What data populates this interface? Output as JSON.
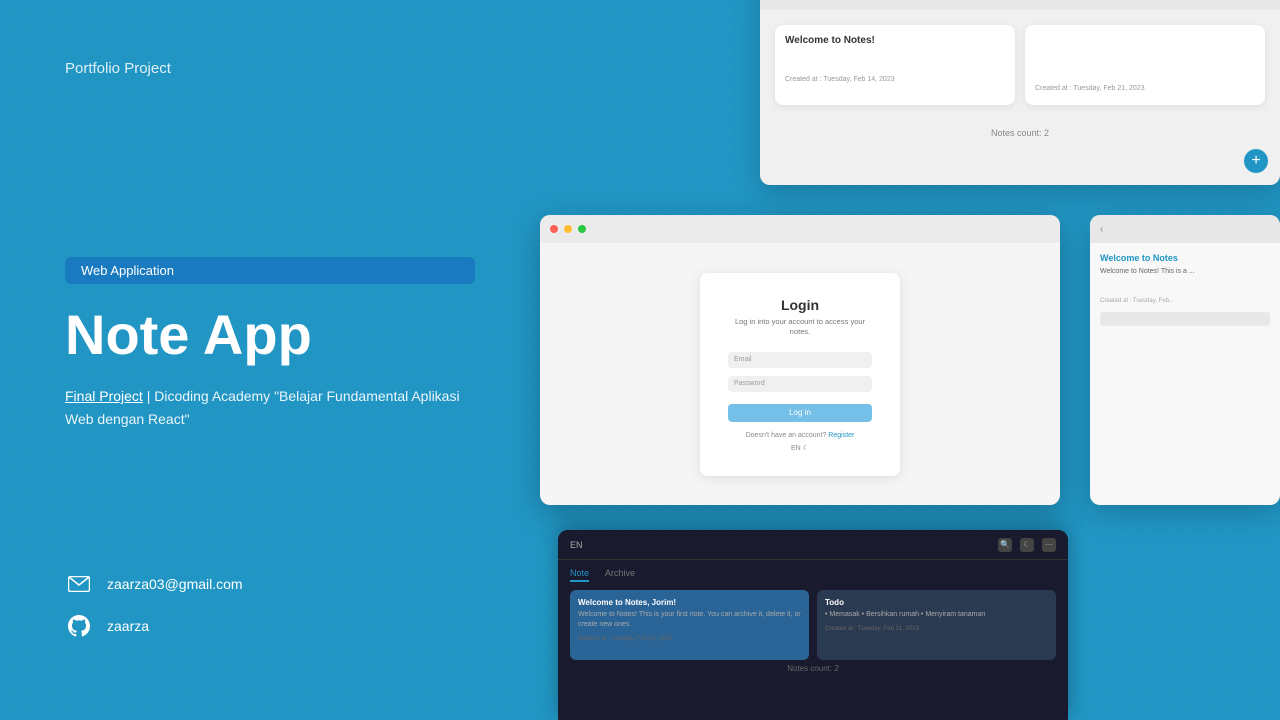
{
  "header": {
    "portfolio_label": "Portfolio Project"
  },
  "badge": {
    "text": "Web Application"
  },
  "app": {
    "title": "Note App",
    "description_link": "Final Project",
    "description_rest": " | Dicoding Academy \"Belajar Fundamental Aplikasi Web dengan React\""
  },
  "contact": {
    "email": "zaarza03@gmail.com",
    "github": "zaarza"
  },
  "screenshots": {
    "top": {
      "card1_title": "Welcome to Notes!",
      "card1_meta": "Created at : Tuesday, Feb 14, 2023",
      "card2_title": "",
      "card2_meta": "Created at : Tuesday, Feb 21, 2023",
      "notes_count": "Notes count: 2"
    },
    "login": {
      "title": "Login",
      "subtitle": "Log in into your account to access your notes.",
      "email_label": "Email",
      "password_label": "Password",
      "button": "Log in",
      "register_text": "Doesn't have an account?",
      "register_link": "Register",
      "lang": "EN"
    },
    "detail": {
      "title": "Welcome to Notes",
      "body": "Welcome to Notes! This is a ...",
      "meta": "Created at : Tuesday, Feb..."
    },
    "dark": {
      "lang": "EN",
      "nav_home": "Note",
      "nav_archive": "Archive",
      "card1_title": "Welcome to Notes, Jorim!",
      "card1_body": "Welcome to Notes! This is your first note. You can archive it, delete it, or create new ones.",
      "card1_meta": "Created at : Tuesday, Feb 14, 2023",
      "card2_title": "Todo",
      "card2_body": "• Memasak • Bersihkan rumah • Menyiram tanaman",
      "card2_meta": "Created at : Tuesday, Feb 21, 2023",
      "notes_count": "Notes count: 2"
    }
  },
  "icons": {
    "email": "✉",
    "github": "⬡",
    "plus": "+",
    "search": "🔍",
    "moon": "☾",
    "chevron": "‹"
  }
}
